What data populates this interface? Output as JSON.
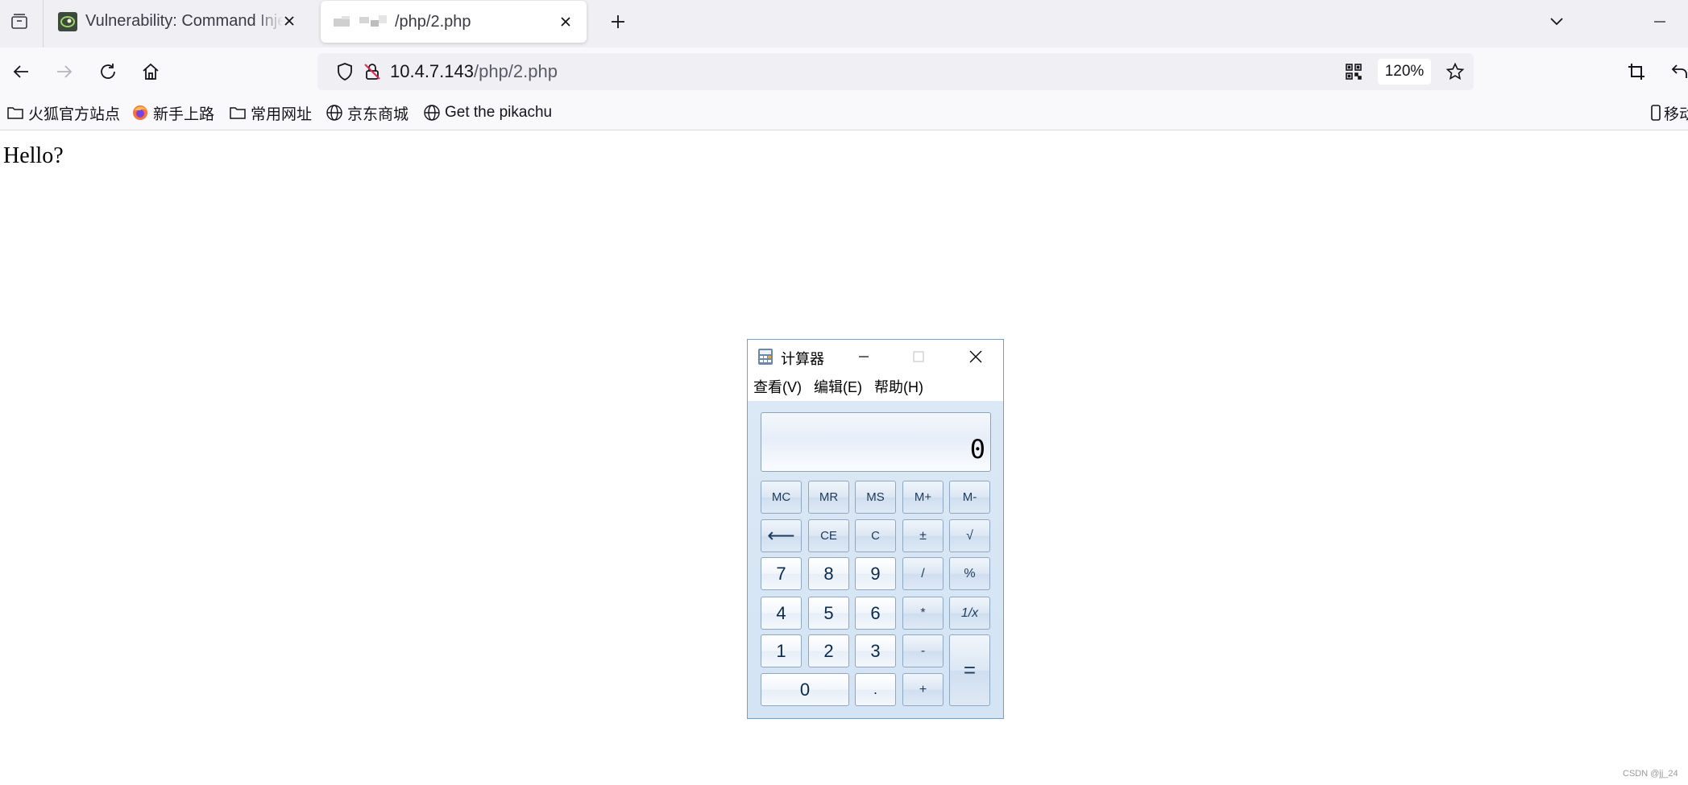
{
  "tabs": [
    {
      "title": "Vulnerability: Command Injection",
      "active": false
    },
    {
      "title": "/php/2.php",
      "active": true
    }
  ],
  "nav": {
    "url_host": "10.4.7.143",
    "url_path": "/php/2.php",
    "zoom": "120%"
  },
  "bookmarks": [
    {
      "label": "火狐官方站点",
      "icon": "folder-icon"
    },
    {
      "label": "新手上路",
      "icon": "firefox-icon"
    },
    {
      "label": "常用网址",
      "icon": "folder-icon"
    },
    {
      "label": "京东商城",
      "icon": "globe-icon"
    },
    {
      "label": "Get the pikachu",
      "icon": "globe-icon"
    }
  ],
  "bookmarks_right": "移动",
  "page": {
    "text": "Hello?",
    "watermark": "CSDN @jj_24"
  },
  "calculator": {
    "title": "计算器",
    "menu": [
      "查看(V)",
      "编辑(E)",
      "帮助(H)"
    ],
    "display": "0",
    "keys": {
      "mc": "MC",
      "mr": "MR",
      "ms": "MS",
      "mplus": "M+",
      "mminus": "M-",
      "back": "⟵",
      "ce": "CE",
      "c": "C",
      "plusminus": "±",
      "sqrt": "√",
      "k7": "7",
      "k8": "8",
      "k9": "9",
      "div": "/",
      "pct": "%",
      "k4": "4",
      "k5": "5",
      "k6": "6",
      "mul": "*",
      "recip": "1/x",
      "k1": "1",
      "k2": "2",
      "k3": "3",
      "sub": "-",
      "eq": "=",
      "k0": "0",
      "dot": ".",
      "add": "+"
    }
  }
}
